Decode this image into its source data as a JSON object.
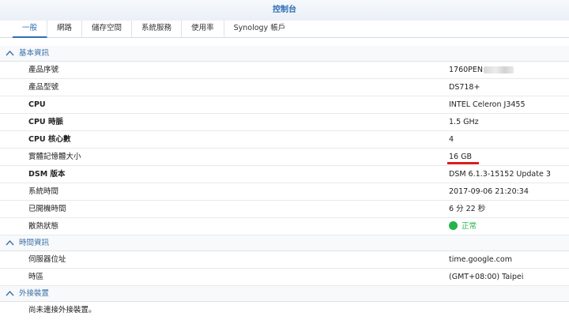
{
  "window": {
    "title": "控制台"
  },
  "tabs": [
    {
      "label": "一般"
    },
    {
      "label": "網路"
    },
    {
      "label": "儲存空間"
    },
    {
      "label": "系統服務"
    },
    {
      "label": "使用率"
    },
    {
      "label": "Synology 帳戶"
    }
  ],
  "basic_info": {
    "title": "基本資訊",
    "rows": [
      {
        "label": "產品序號",
        "value": "1760PEN"
      },
      {
        "label": "產品型號",
        "value": "DS718+"
      },
      {
        "label": "CPU",
        "value": "INTEL Celeron J3455"
      },
      {
        "label": "CPU 時脈",
        "value": "1.5 GHz"
      },
      {
        "label": "CPU 核心數",
        "value": "4"
      },
      {
        "label": "實體記憶體大小",
        "value": "16 GB"
      },
      {
        "label": "DSM 版本",
        "value": "DSM 6.1.3-15152 Update 3"
      },
      {
        "label": "系統時間",
        "value": "2017-09-06 21:20:34"
      },
      {
        "label": "已開機時間",
        "value": "6 分 22 秒"
      },
      {
        "label": "散熱狀態",
        "value": "正常"
      }
    ]
  },
  "time_info": {
    "title": "時間資訊",
    "rows": [
      {
        "label": "伺服器位址",
        "value": "time.google.com"
      },
      {
        "label": "時區",
        "value": "(GMT+08:00) Taipei"
      }
    ]
  },
  "external_devices": {
    "title": "外接裝置",
    "message": "尚未連接外接裝置。"
  },
  "colors": {
    "accent": "#2f6db5",
    "status_ok": "#27b24a",
    "highlight": "#d81e1e"
  },
  "icons": {
    "section_toggle": "chevron-up-icon",
    "thermal_status": "status-ok-dot-icon"
  }
}
